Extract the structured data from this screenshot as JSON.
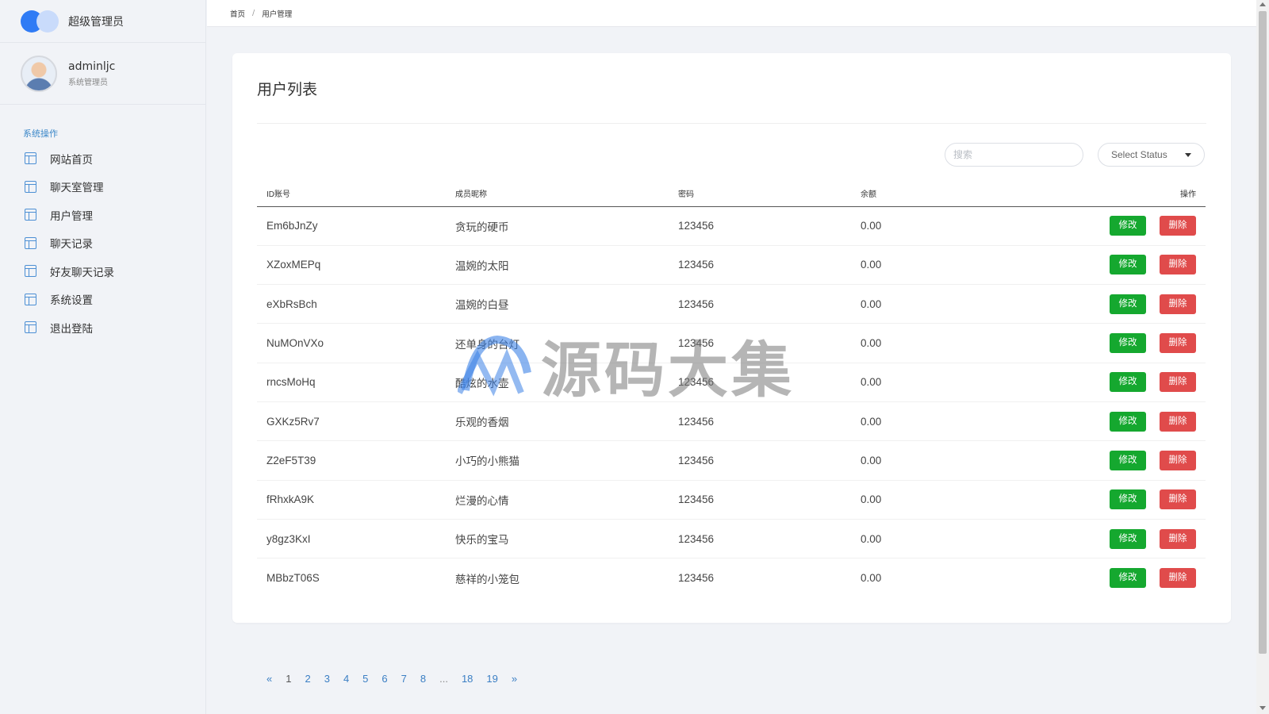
{
  "brand": {
    "title": "超级管理员"
  },
  "profile": {
    "name": "adminljc",
    "role": "系统管理员"
  },
  "sidebar": {
    "heading": "系统操作",
    "items": [
      {
        "label": "网站首页",
        "icon": "layout-icon"
      },
      {
        "label": "聊天室管理",
        "icon": "layout-icon"
      },
      {
        "label": "用户管理",
        "icon": "layout-icon"
      },
      {
        "label": "聊天记录",
        "icon": "layout-icon"
      },
      {
        "label": "好友聊天记录",
        "icon": "layout-icon"
      },
      {
        "label": "系统设置",
        "icon": "layout-icon"
      },
      {
        "label": "退出登陆",
        "icon": "layout-icon"
      }
    ]
  },
  "breadcrumb": {
    "home": "首页",
    "separator": "/",
    "current": "用户管理"
  },
  "main": {
    "title": "用户列表",
    "search_placeholder": "搜索",
    "status_select": "Select Status",
    "table": {
      "headers": [
        "ID账号",
        "成员昵称",
        "密码",
        "余额",
        "操作"
      ],
      "rows": [
        {
          "id": "Em6bJnZy",
          "name": "贪玩的硬币",
          "password": "123456",
          "balance": "0.00"
        },
        {
          "id": "XZoxMEPq",
          "name": "温婉的太阳",
          "password": "123456",
          "balance": "0.00"
        },
        {
          "id": "eXbRsBch",
          "name": "温婉的白昼",
          "password": "123456",
          "balance": "0.00"
        },
        {
          "id": "NuMOnVXo",
          "name": "还单身的台灯",
          "password": "123456",
          "balance": "0.00"
        },
        {
          "id": "rncsMoHq",
          "name": "酷炫的水壶",
          "password": "123456",
          "balance": "0.00"
        },
        {
          "id": "GXKz5Rv7",
          "name": "乐观的香烟",
          "password": "123456",
          "balance": "0.00"
        },
        {
          "id": "Z2eF5T39",
          "name": "小巧的小熊猫",
          "password": "123456",
          "balance": "0.00"
        },
        {
          "id": "fRhxkA9K",
          "name": "烂漫的心情",
          "password": "123456",
          "balance": "0.00"
        },
        {
          "id": "y8gz3KxI",
          "name": "快乐的宝马",
          "password": "123456",
          "balance": "0.00"
        },
        {
          "id": "MBbzT06S",
          "name": "慈祥的小笼包",
          "password": "123456",
          "balance": "0.00"
        }
      ],
      "edit_label": "修改",
      "delete_label": "删除"
    }
  },
  "pagination": {
    "prev": "«",
    "pages": [
      "1",
      "2",
      "3",
      "4",
      "5",
      "6",
      "7",
      "8"
    ],
    "ellipsis": "...",
    "tail_pages": [
      "18",
      "19"
    ],
    "next": "»",
    "current": "1"
  },
  "watermark": {
    "text": "源码大集"
  },
  "colors": {
    "accent": "#2f7bf5",
    "edit": "#15a82f",
    "delete": "#e04b4b",
    "link": "#3b7fc4"
  }
}
